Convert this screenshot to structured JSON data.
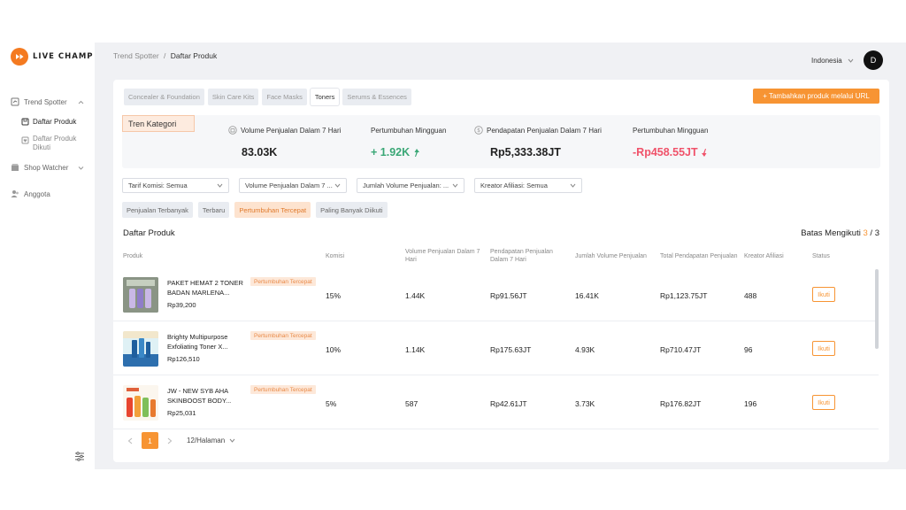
{
  "brand": {
    "name": "LIVE CHAMP"
  },
  "sidebar": {
    "items": [
      {
        "label": "Trend Spotter",
        "icon": "trend-icon"
      },
      {
        "label": "Daftar Produk",
        "icon": "box-icon"
      },
      {
        "label": "Daftar Produk Dikuti",
        "icon": "heart-icon"
      },
      {
        "label": "Shop Watcher",
        "icon": "shop-icon"
      },
      {
        "label": "Anggota",
        "icon": "members-icon"
      }
    ]
  },
  "header": {
    "breadcrumb_parent": "Trend Spotter",
    "breadcrumb_sep": "/",
    "breadcrumb_current": "Daftar Produk",
    "language": "Indonesia",
    "avatar_initial": "D"
  },
  "tabs": [
    "Concealer & Foundation",
    "Skin Care Kits",
    "Face Masks",
    "Toners",
    "Serums & Essences"
  ],
  "active_tab": "Toners",
  "add_button": "+ Tambahkan produk melalui URL",
  "trend": {
    "label": "Tren Kategori",
    "stats": [
      {
        "label": "Volume Penjualan Dalam 7 Hari",
        "value": "83.03K"
      },
      {
        "label": "Pertumbuhan Mingguan",
        "value": "+ 1.92K"
      },
      {
        "label": "Pendapatan Penjualan Dalam 7 Hari",
        "value": "Rp5,333.38JT"
      },
      {
        "label": "Pertumbuhan Mingguan",
        "value": "-Rp458.55JT"
      }
    ]
  },
  "filters": [
    "Tarif Komisi: Semua",
    "Volume Penjualan Dalam 7 ...",
    "Jumlah Volume Penjualan: ...",
    "Kreator Afiliasi: Semua"
  ],
  "sorts": [
    "Penjualan Terbanyak",
    "Terbaru",
    "Pertumbuhan Tercepat",
    "Paling Banyak Diikuti"
  ],
  "active_sort": "Pertumbuhan Tercepat",
  "list": {
    "title": "Daftar Produk",
    "limit_label": "Batas Mengikuti",
    "limit_used": "3",
    "limit_sep": "/",
    "limit_total": "3",
    "columns": [
      "Produk",
      "Komisi",
      "Volume Penjualan Dalam 7 Hari",
      "Pendapatan Penjualan Dalam 7 Hari",
      "Jumlah Volume Penjualan",
      "Total Pendapatan Penjualan",
      "Kreator Afiliasi",
      "Status"
    ],
    "rows": [
      {
        "name": "PAKET HEMAT 2 TONER BADAN MARLENA...",
        "price": "Rp39,200",
        "badge": "Pertumbuhan Tercepat",
        "komisi": "15%",
        "volume7": "1.44K",
        "pendapatan7": "Rp91.56JT",
        "jumlah_volume": "16.41K",
        "total_pendapatan": "Rp1,123.75JT",
        "kreator": "488",
        "status": "Ikuti"
      },
      {
        "name": "Brighty Multipurpose Exfoliating Toner X...",
        "price": "Rp126,510",
        "badge": "Pertumbuhan Tercepat",
        "komisi": "10%",
        "volume7": "1.14K",
        "pendapatan7": "Rp175.63JT",
        "jumlah_volume": "4.93K",
        "total_pendapatan": "Rp710.47JT",
        "kreator": "96",
        "status": "Ikuti"
      },
      {
        "name": "JW - NEW SYB AHA SKINBOOST BODY...",
        "price": "Rp25,031",
        "badge": "Pertumbuhan Tercepat",
        "komisi": "5%",
        "volume7": "587",
        "pendapatan7": "Rp42.61JT",
        "jumlah_volume": "3.73K",
        "total_pendapatan": "Rp176.82JT",
        "kreator": "196",
        "status": "Ikuti"
      }
    ]
  },
  "pagination": {
    "current": "1",
    "per_page": "12/Halaman"
  },
  "colors": {
    "accent": "#f79433",
    "positive": "#3aa776",
    "negative": "#f0526a"
  }
}
